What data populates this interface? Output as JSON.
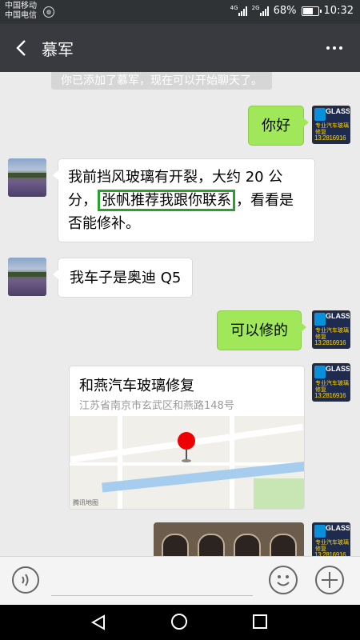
{
  "status_bar": {
    "carrier_1": "中国移动",
    "carrier_2": "中国电信",
    "network_1": "4G",
    "network_2": "2G",
    "battery": "68%",
    "time": "10:32"
  },
  "header": {
    "title": "慕军"
  },
  "messages": {
    "system_notice": "你已添加了慕军，现在可以开始聊天了。",
    "m1": {
      "side": "right",
      "text": "你好"
    },
    "m2": {
      "side": "left",
      "line1": "我前挡风玻璃有开裂，大约 20 公",
      "line2_prefix": "分，",
      "line2_highlight": "张帆推荐我跟你联系",
      "line2_suffix": "，看看是",
      "line3": "否能修补。"
    },
    "m3": {
      "side": "left",
      "text": "我车子是奥迪 Q5"
    },
    "m4": {
      "side": "right",
      "text": "可以修的"
    },
    "m5": {
      "side": "right",
      "type": "location",
      "name": "和燕汽车玻璃修复",
      "address": "江苏省南京市玄武区和燕路148号",
      "map_credit": "腾讯地图"
    },
    "m6": {
      "side": "right",
      "type": "image"
    }
  },
  "avatars": {
    "glass_text": "GLASS",
    "glass_sub": "专业汽车玻璃修复",
    "glass_phone": "13:2816916"
  },
  "colors": {
    "title_bar": "#393a3f",
    "sent_bubble": "#a0e75a",
    "highlight_box": "#2ca02c",
    "pin": "#e00000"
  }
}
